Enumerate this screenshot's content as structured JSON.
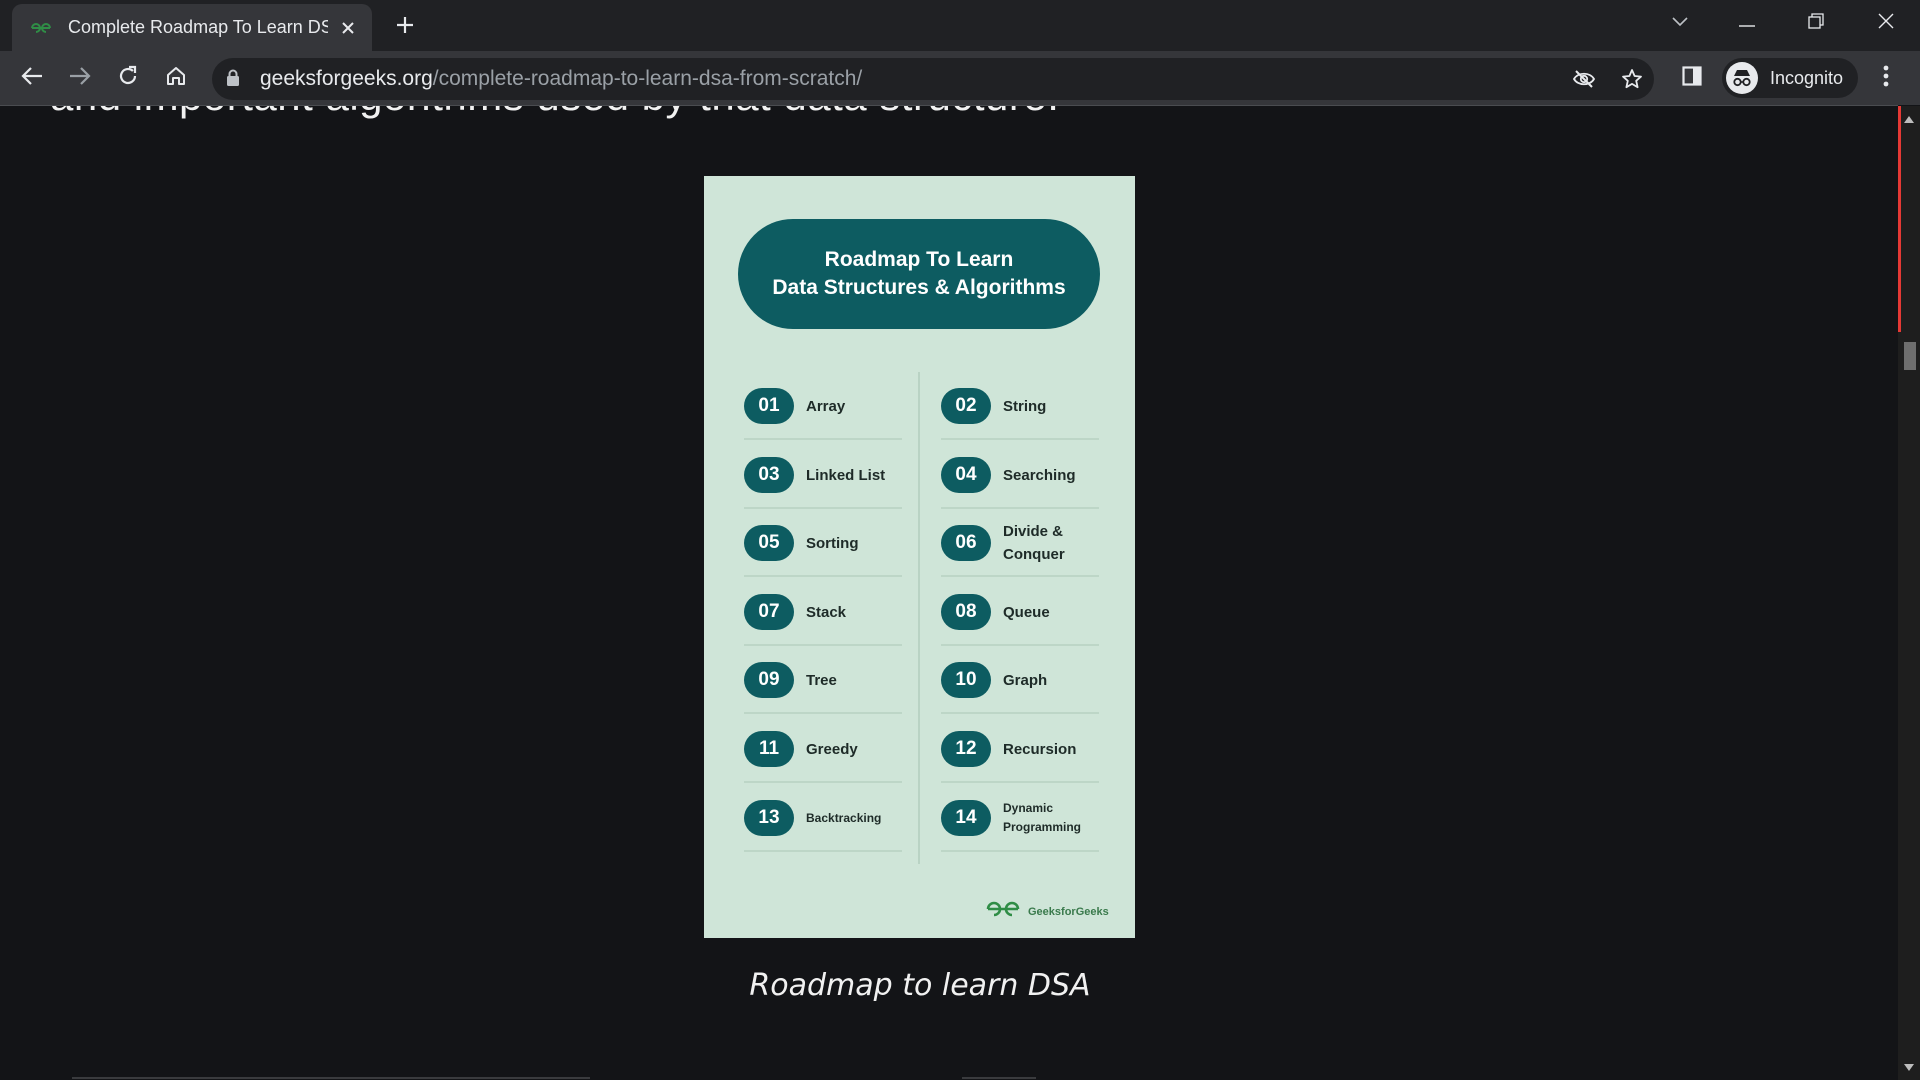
{
  "tab": {
    "title": "Complete Roadmap To Learn DSA From Scratch"
  },
  "address_bar": {
    "host": "geeksforgeeks.org",
    "path": "/complete-roadmap-to-learn-dsa-from-scratch/"
  },
  "profile": {
    "label": "Incognito"
  },
  "page": {
    "intro_text": "and important algorithms used by that data structure.",
    "caption": "Roadmap to learn DSA"
  },
  "roadmap": {
    "title_line1": "Roadmap To Learn",
    "title_line2": "Data Structures & Algorithms",
    "items": [
      {
        "num": "01",
        "label": "Array"
      },
      {
        "num": "02",
        "label": "String"
      },
      {
        "num": "03",
        "label": "Linked List"
      },
      {
        "num": "04",
        "label": "Searching"
      },
      {
        "num": "05",
        "label": "Sorting"
      },
      {
        "num": "06",
        "label": "Divide & Conquer"
      },
      {
        "num": "07",
        "label": "Stack"
      },
      {
        "num": "08",
        "label": "Queue"
      },
      {
        "num": "09",
        "label": "Tree"
      },
      {
        "num": "10",
        "label": "Graph"
      },
      {
        "num": "11",
        "label": "Greedy"
      },
      {
        "num": "12",
        "label": "Recursion"
      },
      {
        "num": "13",
        "label": "Backtracking"
      },
      {
        "num": "14",
        "label": "Dynamic Programming"
      }
    ],
    "brand": "GeeksforGeeks"
  },
  "colors": {
    "roadmap_teal": "#0d5c61",
    "roadmap_background": "#cfe5d8",
    "brand_green": "#2f8d46",
    "scrollbar_accent": "#e53935"
  },
  "icons": [
    "gfg-favicon-icon",
    "close-icon",
    "plus-icon",
    "chevron-down-icon",
    "minimize-icon",
    "restore-icon",
    "back-arrow-icon",
    "forward-arrow-icon",
    "reload-icon",
    "home-icon",
    "lock-icon",
    "eye-off-icon",
    "star-icon",
    "side-panel-icon",
    "incognito-icon",
    "more-vert-icon"
  ]
}
